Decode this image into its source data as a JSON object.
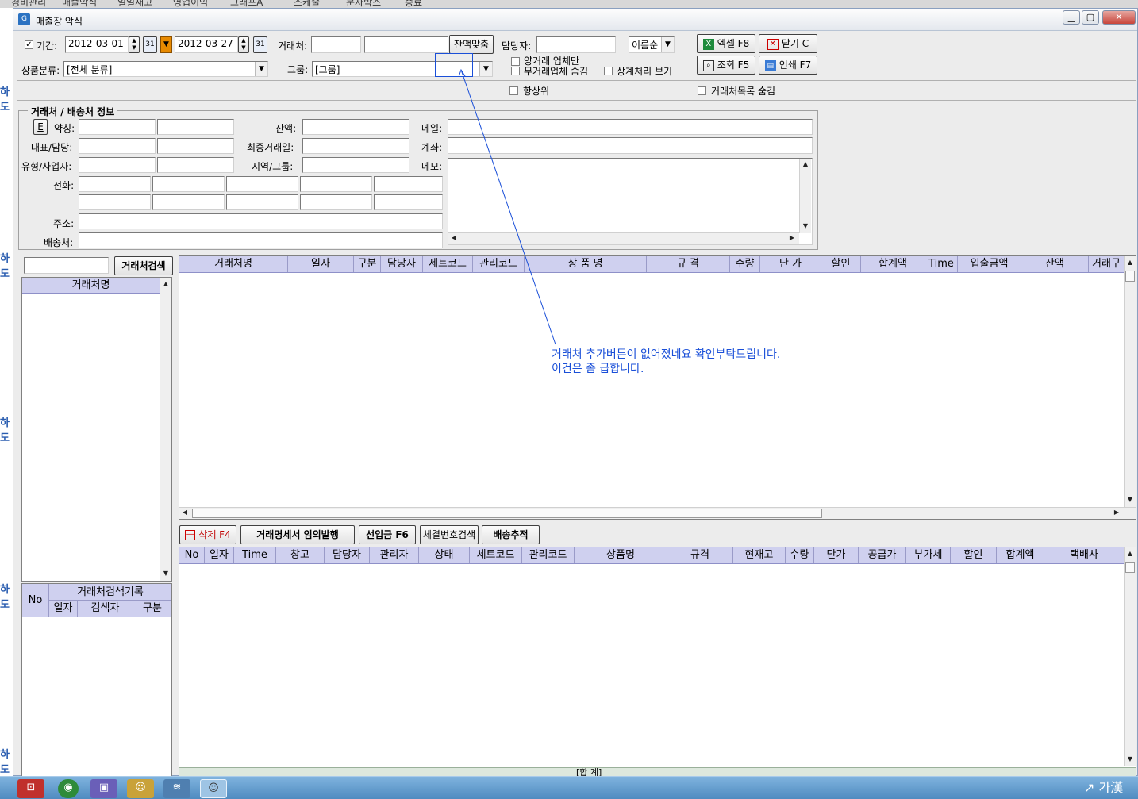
{
  "top_menu": [
    "경비관리",
    "매출악식",
    "일일재고",
    "영업이익",
    "그래프A",
    "스케줄",
    "문자박스",
    "종료"
  ],
  "window": {
    "title": "매출장 악식",
    "min": "▁",
    "max": "▢",
    "close": "✕"
  },
  "filters": {
    "period_label": "기간:",
    "date_from": "2012-03-01",
    "date_to": "2012-03-27",
    "client_label": "거래처:",
    "client_code": "",
    "client_name": "",
    "balance_button": "잔액맞춤",
    "staff_label": "담당자:",
    "staff_value": "",
    "sort_value": "이름순",
    "category_label": "상품분류:",
    "category_value": "[전체 분류]",
    "group_label": "그룹:",
    "group_value": "[그룹]",
    "check_positive_only": "양거래 업체만",
    "check_hide_no_trade": "무거래업체 숨김",
    "check_show_settlement": "상계처리 보기",
    "check_top": "항상위",
    "check_hide_client_list": "거래처목록 숨김"
  },
  "actions": {
    "excel": "엑셀 F8",
    "close": "닫기 C",
    "query": "조회 F5",
    "print": "인쇄 F7"
  },
  "info": {
    "section_title": "거래처 / 배송처 정보",
    "e_button": "E",
    "name_label": "약칭:",
    "rep_label": "대표/담당:",
    "type_label": "유형/사업자:",
    "phone_label": "전화:",
    "address_label": "주소:",
    "delivery_label": "배송처:",
    "balance_label": "잔액:",
    "last_trade_label": "최종거래일:",
    "region_label": "지역/그룹:",
    "email_label": "메일:",
    "account_label": "계좌:",
    "memo_label": "메모:"
  },
  "client_search": {
    "search_input": "",
    "search_button": "거래처검색",
    "list_header": "거래처명",
    "log_no": "No",
    "log_title": "거래처검색기록",
    "log_cols": [
      "일자",
      "검색자",
      "구분"
    ]
  },
  "main_grid": {
    "columns": [
      "거래처명",
      "일자",
      "구분",
      "담당자",
      "세트코드",
      "관리코드",
      "상 품 명",
      "규 격",
      "수량",
      "단 가",
      "할인",
      "합계액",
      "Time",
      "입출금액",
      "잔액",
      "거래구"
    ]
  },
  "detail_toolbar": {
    "delete": "삭제 F4",
    "statement": "거래명세서 임의발행",
    "prepay": "선입금 F6",
    "contract_search": "체결번호검색",
    "delivery_track": "배송추적"
  },
  "detail_grid": {
    "columns": [
      "No",
      "일자",
      "Time",
      "창고",
      "담당자",
      "관리자",
      "상태",
      "세트코드",
      "관리코드",
      "상품명",
      "규격",
      "현재고",
      "수량",
      "단가",
      "공급가",
      "부가세",
      "할인",
      "합계액",
      "택배사"
    ],
    "footer": "[합 계]"
  },
  "annotation": {
    "line1": "거래처 추가버튼이 없어졌네요 확인부탁드립니다.",
    "line2": "이건은 좀 급합니다."
  },
  "left_strip": [
    "하도",
    "하도",
    "하도",
    "하도",
    "하도"
  ],
  "taskbar": {
    "ime": "가漢"
  },
  "colors": {
    "grid_header": "#cfd0ef",
    "annotation": "#1a4fd8",
    "accent_orange": "#e88a00"
  }
}
